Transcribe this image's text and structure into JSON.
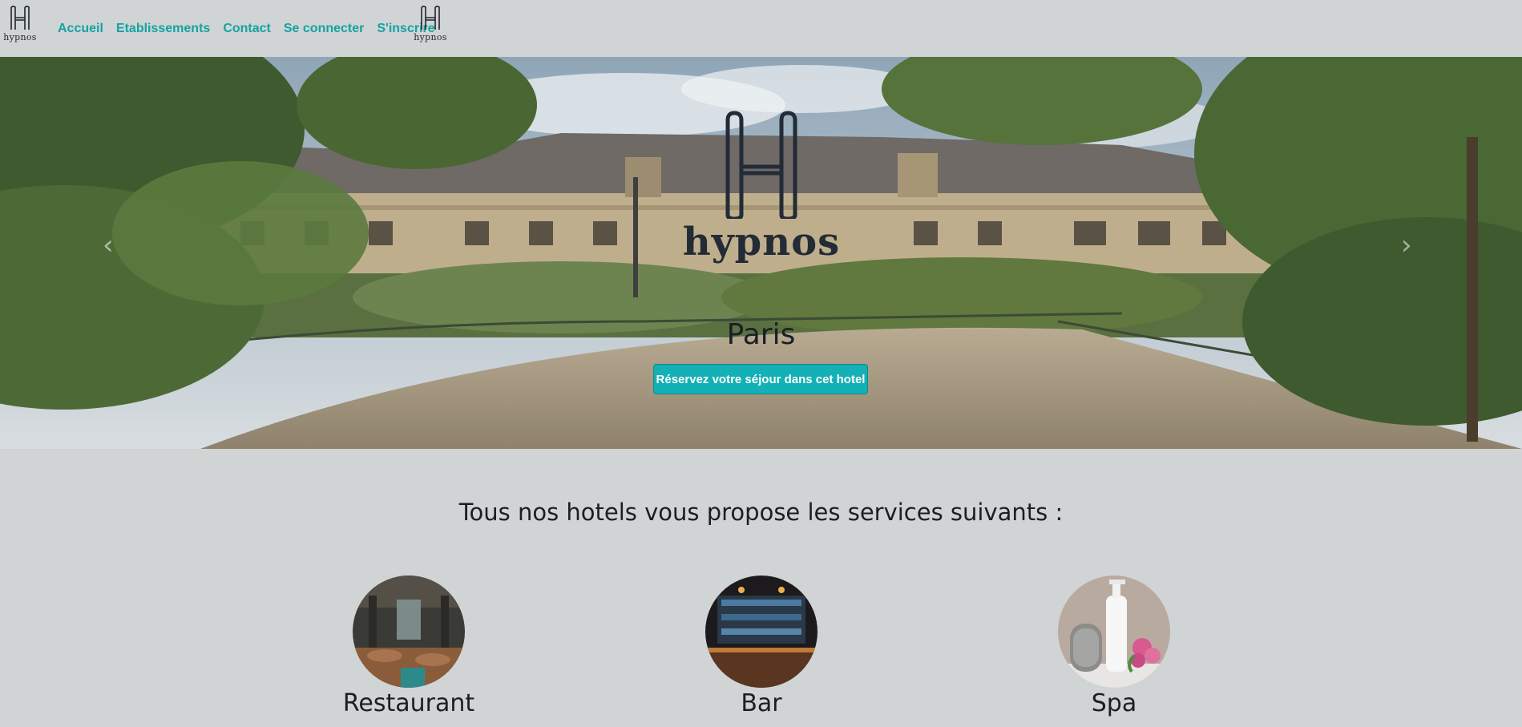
{
  "navbar": {
    "logo_text": "hypnos",
    "links": [
      "Accueil",
      "Etablissements",
      "Contact",
      "Se connecter",
      "S'inscrire"
    ],
    "link_color": "#14a3a3"
  },
  "hero": {
    "logo_text": "hypnos",
    "city": "Paris",
    "cta_label": "Réservez votre séjour dans cet hotel",
    "cta_color": "#13b0b5",
    "prev_icon": "‹",
    "next_icon": "›"
  },
  "services": {
    "title": "Tous nos hotels vous propose les services suivants :",
    "items": [
      {
        "label": "Restaurant",
        "icon": "restaurant-photo"
      },
      {
        "label": "Bar",
        "icon": "bar-photo"
      },
      {
        "label": "Spa",
        "icon": "spa-photo"
      }
    ]
  }
}
